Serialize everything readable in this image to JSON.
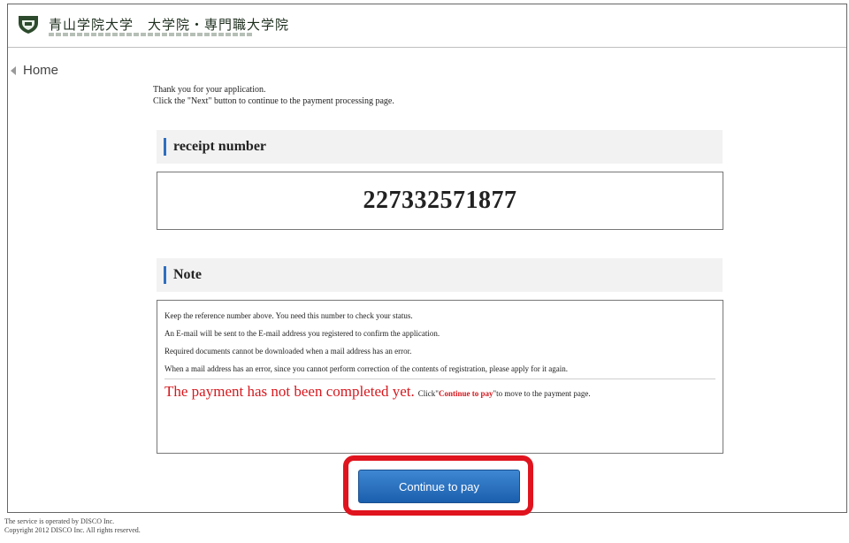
{
  "header": {
    "logo_name": "青山学院大学　大学院・専門職大学院"
  },
  "nav": {
    "home_label": "Home"
  },
  "intro": {
    "line1": "Thank you for your application.",
    "line2": "Click the \"Next\" button to continue to the payment processing page."
  },
  "receipt": {
    "heading": "receipt number",
    "number": "227332571877"
  },
  "note": {
    "heading": "Note",
    "lines": [
      "Keep the reference number above. You need this number to check your status.",
      "An E-mail will be sent to the E-mail address you registered to confirm the application.",
      "Required documents cannot be downloaded when a mail address has an error.",
      "When a mail address has an error, since you cannot perform correction of the contents of registration, please apply for it again."
    ],
    "warning_big": "The payment has not been completed yet.",
    "warning_pre": "Click\"",
    "warning_action": "Continue to pay",
    "warning_post": "\"to move to the payment page."
  },
  "actions": {
    "continue_label": "Continue to pay"
  },
  "footer": {
    "line1": "The service is operated by DISCO Inc.",
    "line2": "Copyright 2012 DISCO Inc. All rights reserved."
  },
  "colors": {
    "accent_blue": "#2f6fbf",
    "warning_red": "#d7181e",
    "highlight_red": "#e0141e"
  },
  "icons": {
    "logo": "university-seal-icon",
    "home": "back-arrow-icon"
  }
}
